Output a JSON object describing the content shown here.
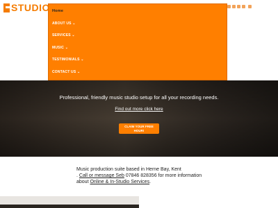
{
  "brand": {
    "logo_text": "STUDIO",
    "accent": "#ff7f00"
  },
  "social": {
    "icons": [
      "facebook-icon",
      "twitter-icon",
      "linkedin-icon",
      "google-plus-icon",
      "youtube-icon",
      "instagram-icon",
      "flickr-icon",
      "pinterest-icon"
    ]
  },
  "menu": {
    "items": [
      {
        "label": "Home"
      },
      {
        "label": "ABOUT US ⌄"
      },
      {
        "label": "SERVICES ⌄"
      },
      {
        "label": "MUSIC ⌄"
      },
      {
        "label": "TESTIMONIALS ⌄"
      },
      {
        "label": "CONTACT US ⌄"
      }
    ]
  },
  "hero": {
    "tagline": "Professional, friendly music studio setup for all your recording needs.",
    "link_text": "Find out more click here",
    "cta_line1": "CLAIM YOUR FREE",
    "cta_line2": "HOUR!"
  },
  "about": {
    "text_1": "Music production suite based in Herne Bay, Kent",
    "text_2": ". ",
    "link_call": "Call or message Seb",
    "text_3": " 07846 828356 for more information about ",
    "link_services": "Online & In-Studio Services",
    "text_4": "."
  }
}
